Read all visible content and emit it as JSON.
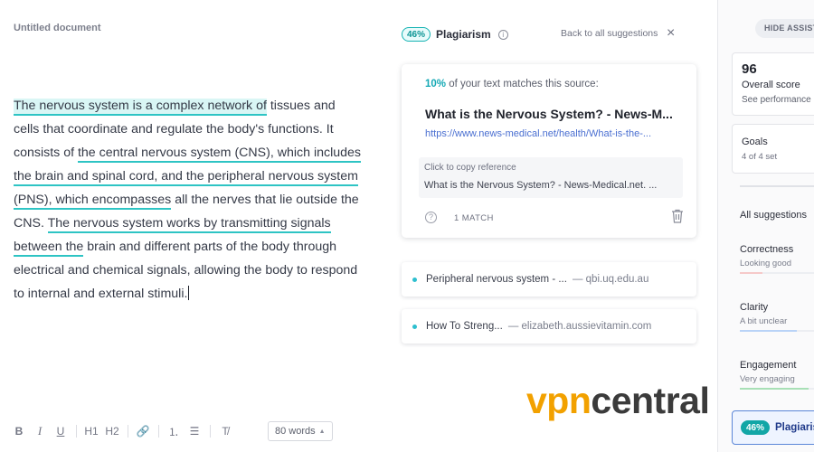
{
  "document": {
    "title": "Untitled document",
    "segments": [
      {
        "text": "The nervous system is a complex network of",
        "highlight": "active"
      },
      {
        "text": " tissues and cells that coordinate and regulate the body's functions. It consists of ",
        "highlight": "none"
      },
      {
        "text": "the central nervous system (CNS), which includes the brain and spinal cord, and the peripheral nervous system (PNS), which encompasses",
        "highlight": "underline"
      },
      {
        "text": " all the nerves that lie outside the CNS. ",
        "highlight": "none"
      },
      {
        "text": "The nervous system works by transmitting signals between the",
        "highlight": "underline"
      },
      {
        "text": " brain and different parts of the body through electrical and chemical signals, allowing the body to respond to internal and external stimuli.",
        "highlight": "none"
      }
    ]
  },
  "toolbar": {
    "buttons": [
      {
        "name": "bold-button",
        "label": "B",
        "cls": "bold"
      },
      {
        "name": "italic-button",
        "label": "I",
        "cls": "italic"
      },
      {
        "name": "underline-button",
        "label": "U",
        "cls": "underline"
      },
      {
        "name": "heading1-button",
        "label": "H1",
        "cls": "",
        "sepBefore": true
      },
      {
        "name": "heading2-button",
        "label": "H2",
        "cls": ""
      },
      {
        "name": "link-icon",
        "label": "🔗",
        "cls": "",
        "sepBefore": true
      },
      {
        "name": "numbered-list-icon",
        "label": "⒈",
        "cls": "",
        "sepBefore": true
      },
      {
        "name": "bulleted-list-icon",
        "label": "☰",
        "cls": ""
      },
      {
        "name": "clear-format-icon",
        "label": "T̸",
        "cls": "",
        "sepBefore": true
      }
    ],
    "word_count": "80 words"
  },
  "plagiarism": {
    "badge": "46%",
    "title": "Plagiarism",
    "back_label": "Back to all suggestions",
    "card": {
      "match_pct": "10%",
      "match_text": "of your text matches this source:",
      "source_title": "What is the Nervous System? - News-M...",
      "source_url": "https://www.news-medical.net/health/What-is-the-...",
      "copy_label": "Click to copy reference",
      "copy_reference": "What is the Nervous System? - News-Medical.net. ...",
      "match_count": "1 MATCH"
    },
    "other_sources": [
      {
        "name": "Peripheral nervous system - ...",
        "domain": "— qbi.uq.edu.au"
      },
      {
        "name": "How To Streng...",
        "domain": "— elizabeth.aussievitamin.com"
      }
    ]
  },
  "sidebar": {
    "hide_label": "HIDE ASSISTANT",
    "overall_score": "96",
    "overall_label": "Overall score",
    "performance_link": "See performance",
    "goals_title": "Goals",
    "goals_sub": "4 of 4 set",
    "all_suggestions": "All suggestions",
    "categories": [
      {
        "name": "Correctness",
        "status": "Looking good",
        "fill": 0.3,
        "color": "#f6c9c9"
      },
      {
        "name": "Clarity",
        "status": "A bit unclear",
        "fill": 0.75,
        "color": "#b9d3f7"
      },
      {
        "name": "Engagement",
        "status": "Very engaging",
        "fill": 0.9,
        "color": "#a8e0b6"
      }
    ],
    "plagiarism_badge": "46%",
    "plagiarism_label": "Plagiarism"
  },
  "watermark": {
    "part_a": "vpn",
    "part_b": "central"
  }
}
